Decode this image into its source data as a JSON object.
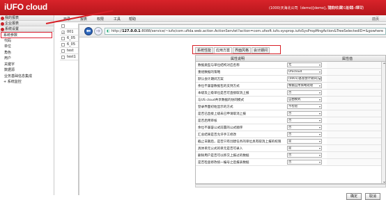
{
  "header": {
    "logo": "iUFO cloud",
    "user_info": "(1000)天海北公司（demo)[demo]，您好！2018-05-02",
    "links": [
      "我的收藏",
      "注销",
      "帮助"
    ],
    "brand_color": "#d8232a"
  },
  "sidebar": {
    "sections": [
      "我的报表",
      "企业报表",
      "系统设置"
    ],
    "items": [
      "系统参数",
      "代码",
      "单位",
      "角色",
      "用户",
      "关键字",
      "数据源",
      "业务基础信息集成"
    ],
    "bottom_section": "系统监控"
  },
  "toolbar": {
    "items": [
      "目录",
      "报表",
      "权限",
      "工具",
      "帮助"
    ],
    "right_label": "前页"
  },
  "grid": {
    "rows": [
      {
        "label": "",
        "checked": false
      },
      {
        "label": "001",
        "checked": true
      },
      {
        "label": "6_05",
        "checked": false
      },
      {
        "label": "6_05",
        "checked": false
      },
      {
        "label": "test",
        "checked": false
      },
      {
        "label": "test1",
        "checked": false
      }
    ]
  },
  "browser": {
    "url_prefix": "http://",
    "url_host": "127.0.0.1",
    "url_rest": ":8088/service/~iufo/com.ufida.web.action.ActionServlet?action=com.ufsoft.iufo.sysprop.iufoSysPropMngAction&TreeSelectedID=&gowhere"
  },
  "tabs": [
    "系统性能",
    "应用方案",
    "界面风格",
    "会计期间"
  ],
  "active_tab": 1,
  "prop_table": {
    "headers": [
      "属性说明",
      "属性值"
    ],
    "rows": [
      {
        "name": "数据类型与单位结构对应名称",
        "value": "无"
      },
      {
        "name": "重组数据的策略",
        "value": "Ufocloud"
      },
      {
        "name": "默认会计期间方案",
        "value": "(0001)基准会计期间方案"
      },
      {
        "name": "余位不兼容数据包的支持方式",
        "value": "根据应用策略处理"
      },
      {
        "name": "本级及上级单位是否可直接取消上报",
        "value": "否"
      },
      {
        "name": "与US cloud共享数据的协同模式",
        "value": "自由模式"
      },
      {
        "name": "登录界面初始显示的方式",
        "value": "不检验"
      },
      {
        "name": "是否已直接上级未已申请取消上报",
        "value": "否"
      },
      {
        "name": "是否启用审核",
        "value": "否"
      },
      {
        "name": "余位不兼容公式前置的公式顺序",
        "value": "否"
      },
      {
        "name": "汇总结果是否允许手工修改",
        "value": "否"
      },
      {
        "name": "截止日期后，是否只有创建任务的单位具有取消上报的权限",
        "value": "是"
      },
      {
        "name": "具体单元公式的单元是否可录入",
        "value": "是"
      },
      {
        "name": "删除用户是否可以移交上报过的数据",
        "value": "否"
      },
      {
        "name": "是否检查修改统一编号之后报表数据",
        "value": "否"
      }
    ]
  },
  "dialog_buttons": [
    "确定",
    "取消"
  ]
}
